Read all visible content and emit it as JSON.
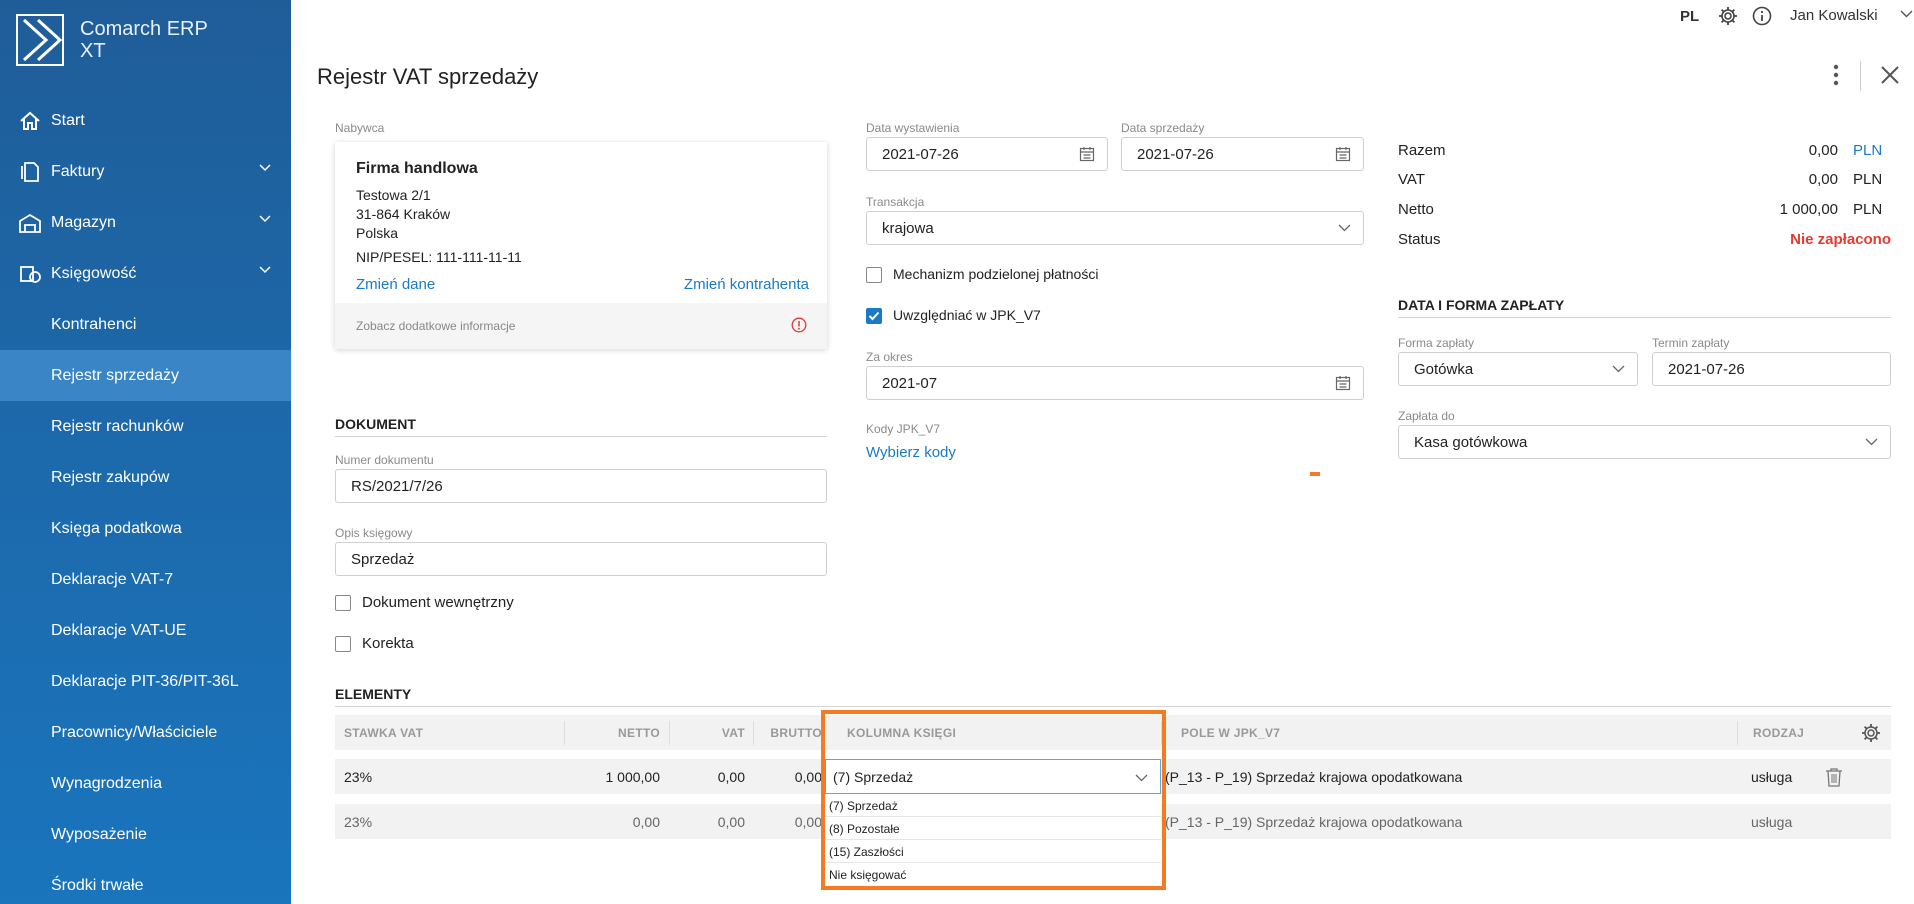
{
  "app": {
    "name": "Comarch ERP XT"
  },
  "topbar": {
    "lang": "PL",
    "user": "Jan Kowalski"
  },
  "sidebar": {
    "items": [
      {
        "label": "Start",
        "icon": "home-icon"
      },
      {
        "label": "Faktury",
        "icon": "document-icon"
      },
      {
        "label": "Magazyn",
        "icon": "warehouse-icon"
      },
      {
        "label": "Księgowość",
        "icon": "accounting-icon"
      },
      {
        "label": "Kontrahenci"
      },
      {
        "label": "Rejestr sprzedaży"
      },
      {
        "label": "Rejestr rachunków"
      },
      {
        "label": "Rejestr zakupów"
      },
      {
        "label": "Księga podatkowa"
      },
      {
        "label": "Deklaracje VAT-7"
      },
      {
        "label": "Deklaracje VAT-UE"
      },
      {
        "label": "Deklaracje PIT-36/PIT-36L"
      },
      {
        "label": "Pracownicy/Właściciele"
      },
      {
        "label": "Wynagrodzenia"
      },
      {
        "label": "Wyposażenie"
      },
      {
        "label": "Środki trwałe"
      }
    ]
  },
  "page": {
    "title": "Rejestr VAT sprzedaży"
  },
  "buyer": {
    "label": "Nabywca",
    "name": "Firma handlowa",
    "street": "Testowa 2/1",
    "city": "31-864 Kraków",
    "country": "Polska",
    "nip": "NIP/PESEL: 111-111-11-11",
    "change_data": "Zmień dane",
    "change_contractor": "Zmień kontrahenta",
    "more_info": "Zobacz dodatkowe informacje"
  },
  "document": {
    "section": "DOKUMENT",
    "number_label": "Numer dokumentu",
    "number_value": "RS/2021/7/26",
    "desc_label": "Opis księgowy",
    "desc_value": "Sprzedaż",
    "internal": "Dokument wewnętrzny",
    "correction": "Korekta"
  },
  "dates": {
    "issue_label": "Data wystawienia",
    "issue_value": "2021-07-26",
    "sale_label": "Data sprzedaży",
    "sale_value": "2021-07-26",
    "transaction_label": "Transakcja",
    "transaction_value": "krajowa",
    "split_payment": "Mechanizm podzielonej płatności",
    "jpk_include": "Uwzględniać w JPK_V7",
    "period_label": "Za okres",
    "period_value": "2021-07",
    "jpk_codes_label": "Kody JPK_V7",
    "jpk_codes_link": "Wybierz kody"
  },
  "totals": {
    "rows": [
      {
        "label": "Razem",
        "value": "0,00",
        "currency": "PLN"
      },
      {
        "label": "VAT",
        "value": "0,00",
        "currency": "PLN"
      },
      {
        "label": "Netto",
        "value": "1 000,00",
        "currency": "PLN"
      }
    ],
    "status_label": "Status",
    "status_value": "Nie zapłacono",
    "colors": {
      "link": "#1a7ac7",
      "status": "#e03c31",
      "highlight": "#f27b24"
    }
  },
  "payment": {
    "section": "DATA I FORMA ZAPŁATY",
    "method_label": "Forma zapłaty",
    "method_value": "Gotówka",
    "due_label": "Termin zapłaty",
    "due_value": "2021-07-26",
    "to_label": "Zapłata do",
    "to_value": "Kasa gotówkowa"
  },
  "elements": {
    "section": "ELEMENTY",
    "headers": [
      "STAWKA VAT",
      "NETTO",
      "VAT",
      "BRUTTO",
      "KOLUMNA KSIĘGI",
      "POLE W JPK_V7",
      "RODZAJ"
    ],
    "rows": [
      {
        "rate": "23%",
        "net": "1 000,00",
        "vat": "0,00",
        "gross": "0,00",
        "column": "(7) Sprzedaż",
        "jpk": "(P_13 - P_19) Sprzedaż krajowa opodatkowana",
        "kind": "usługa"
      },
      {
        "rate": "23%",
        "net": "0,00",
        "vat": "0,00",
        "gross": "0,00",
        "column": "",
        "jpk": "(P_13 - P_19) Sprzedaż krajowa opodatkowana",
        "kind": "usługa"
      }
    ],
    "dropdown_options": [
      "(7) Sprzedaż",
      "(8) Pozostałe",
      "(15) Zaszłości",
      "Nie księgować"
    ]
  }
}
